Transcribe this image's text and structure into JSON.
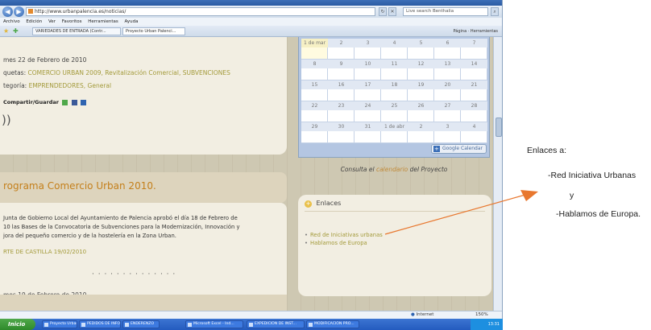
{
  "browser": {
    "url": "http://www.urbanpalencia.es/noticias/",
    "search_placeholder": "Live search Benthalia",
    "menu": [
      "Archivo",
      "Edición",
      "Ver",
      "Favoritos",
      "Herramientas",
      "Ayuda"
    ],
    "tabs": [
      "VARIEDADES DE ENTRADA (Contr...",
      "Proyecto Urban Palenci..."
    ],
    "toolbar_right": "Página  ·  Herramientas"
  },
  "post1": {
    "date": "mes 22 de Febrero de 2010",
    "tags_label": "quetas:",
    "tags": "COMERCIO URBAN 2009, Revitalización Comercial, SUBVENCIONES",
    "category_label": "tegoría:",
    "categories": "EMPRENDEDORES, General",
    "share_label": "Compartir/Guardar"
  },
  "post2": {
    "title": "rograma Comercio Urban 2010.",
    "body": [
      "Junta de Gobierno Local del Ayuntamiento de Palencia aprobó el día 18 de Febrero de",
      "10 las Bases de la Convocatoria de Subvenciones para la Modernización, Innovación y",
      "jora del pequeño comercio y de la hostelería en la Zona Urban."
    ],
    "source": "RTE DE CASTILLA 19/02/2010",
    "next_date": "mes 19 de Febrero de 2010"
  },
  "calendar": {
    "rows": [
      [
        "1 de mar",
        "2",
        "3",
        "4",
        "5",
        "6",
        "7"
      ],
      [
        "8",
        "9",
        "10",
        "11",
        "12",
        "13",
        "14"
      ],
      [
        "15",
        "16",
        "17",
        "18",
        "19",
        "20",
        "21"
      ],
      [
        "22",
        "23",
        "24",
        "25",
        "26",
        "27",
        "28"
      ],
      [
        "29",
        "30",
        "31",
        "1 de abr",
        "2",
        "3",
        "4"
      ]
    ],
    "google_button": "Google Calendar",
    "consulta_prefix": "Consulta el",
    "consulta_link": "calendario",
    "consulta_suffix": "del Proyecto"
  },
  "enlaces": {
    "heading": "Enlaces",
    "links": [
      "Red de Iniciativas urbanas",
      "Hablamos de Europa"
    ]
  },
  "statusbar": {
    "zone": "Internet",
    "zoom": "150%"
  },
  "taskbar": {
    "start": "Inicio",
    "tasks": [
      "Proyecto Urban Pale...",
      "PEDIDOS DE INFORM...",
      "ENDERENZO",
      "Microsoft Excel - Ind...",
      "EXPEDICIÓN DE INST...",
      "MODIFICACIÓN PRO..."
    ],
    "clock": "13:31"
  },
  "annotation": {
    "lines": [
      "Enlaces a:",
      "-Red Iniciativa Urbanas",
      "y",
      "-Hablamos de Europa."
    ],
    "arrow_color": "#e8772e"
  }
}
